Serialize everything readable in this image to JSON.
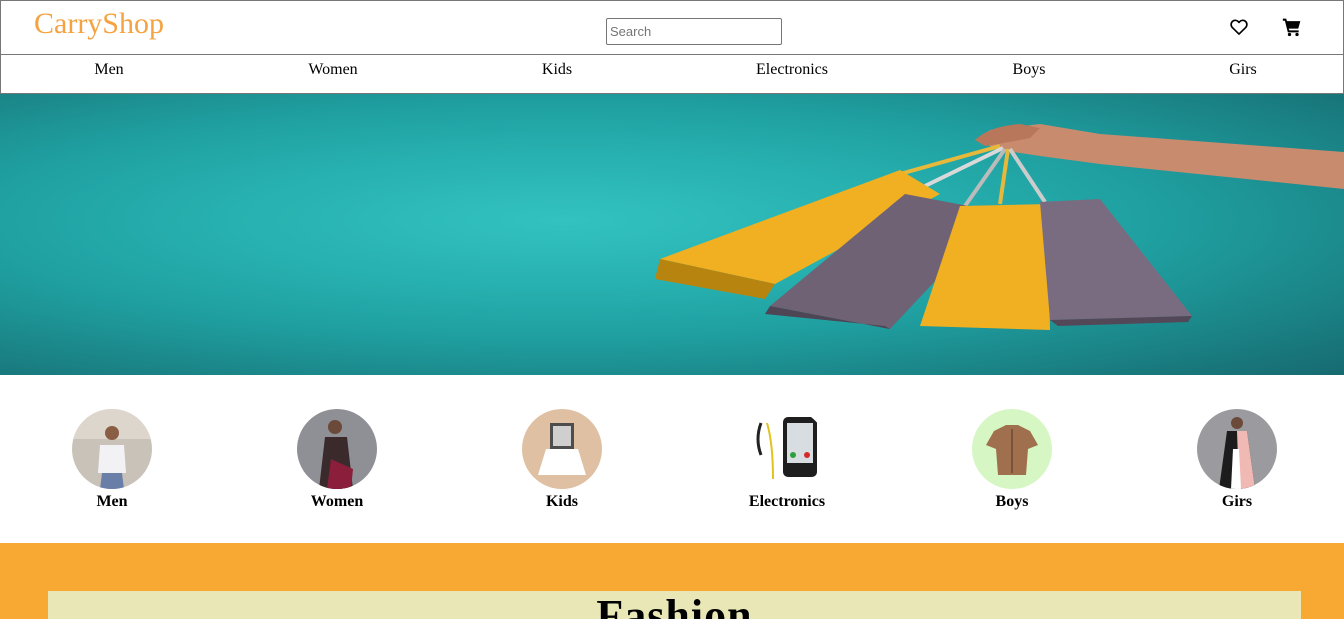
{
  "header": {
    "logo": "CarryShop",
    "search_placeholder": "Search",
    "icons": [
      "heart-icon",
      "cart-icon"
    ]
  },
  "nav": {
    "items": [
      "Men",
      "Women",
      "Kids",
      "Electronics",
      "Boys",
      "Girs"
    ]
  },
  "categories": [
    {
      "label": "Men",
      "icon": "men-photo"
    },
    {
      "label": "Women",
      "icon": "women-photo"
    },
    {
      "label": "Kids",
      "icon": "kids-photo"
    },
    {
      "label": "Electronics",
      "icon": "electronics-photo"
    },
    {
      "label": "Boys",
      "icon": "boys-photo"
    },
    {
      "label": "Girs",
      "icon": "girls-photo"
    }
  ],
  "promo": {
    "title": "Fashion"
  },
  "colors": {
    "brand": "#f4a340",
    "banner": "#27b1b0",
    "promo_bg": "#f7a934",
    "promo_box": "#e9e7b5"
  }
}
